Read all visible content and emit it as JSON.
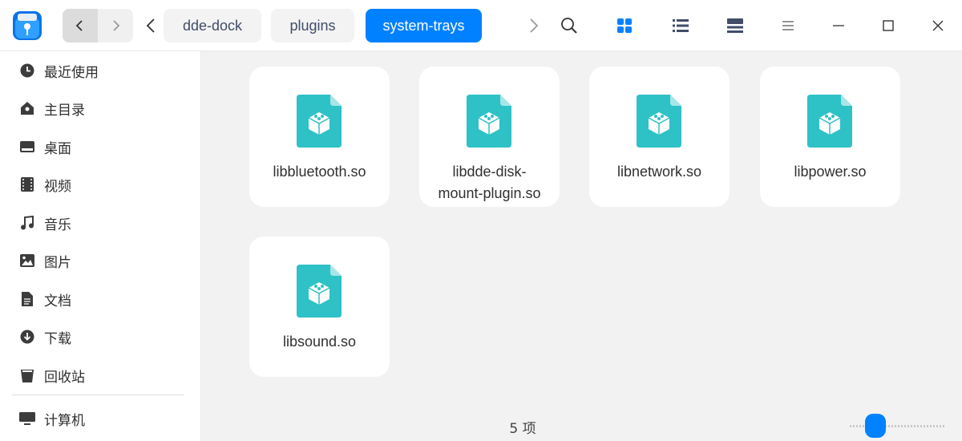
{
  "window": {
    "breadcrumbs": [
      "dde-dock",
      "plugins",
      "system-trays"
    ],
    "active_breadcrumb": "system-trays"
  },
  "toolbar": {
    "icons": [
      "back-arrow-icon",
      "forward-arrow-icon",
      "breadcrumb-prev-icon",
      "breadcrumb-next-icon",
      "search-icon",
      "icon-view-icon",
      "list-view-icon",
      "tree-view-icon",
      "menu-icon",
      "minimize-icon",
      "maximize-icon",
      "close-icon"
    ],
    "view_mode": "icon"
  },
  "sidebar": {
    "items": [
      {
        "label": "最近使用",
        "icon": "clock-icon"
      },
      {
        "label": "主目录",
        "icon": "home-icon"
      },
      {
        "label": "桌面",
        "icon": "desktop-icon"
      },
      {
        "label": "视频",
        "icon": "video-icon"
      },
      {
        "label": "音乐",
        "icon": "music-icon"
      },
      {
        "label": "图片",
        "icon": "picture-icon"
      },
      {
        "label": "文档",
        "icon": "document-icon"
      },
      {
        "label": "下载",
        "icon": "download-icon"
      },
      {
        "label": "回收站",
        "icon": "trash-icon"
      },
      {
        "label": "计算机",
        "icon": "computer-icon"
      }
    ]
  },
  "files": [
    {
      "name_lines": [
        "libbluetooth.so",
        ""
      ]
    },
    {
      "name_lines": [
        "libdde-disk-",
        "mount-plugin.so"
      ]
    },
    {
      "name_lines": [
        "libnetwork.so",
        ""
      ]
    },
    {
      "name_lines": [
        "libpower.so",
        ""
      ]
    },
    {
      "name_lines": [
        "libsound.so",
        ""
      ]
    }
  ],
  "status": {
    "item_count": "5 项"
  },
  "zoom": {
    "level_fraction": 0.2
  },
  "colors": {
    "accent": "#0081ff",
    "file_icon": "#2ec1c6"
  }
}
